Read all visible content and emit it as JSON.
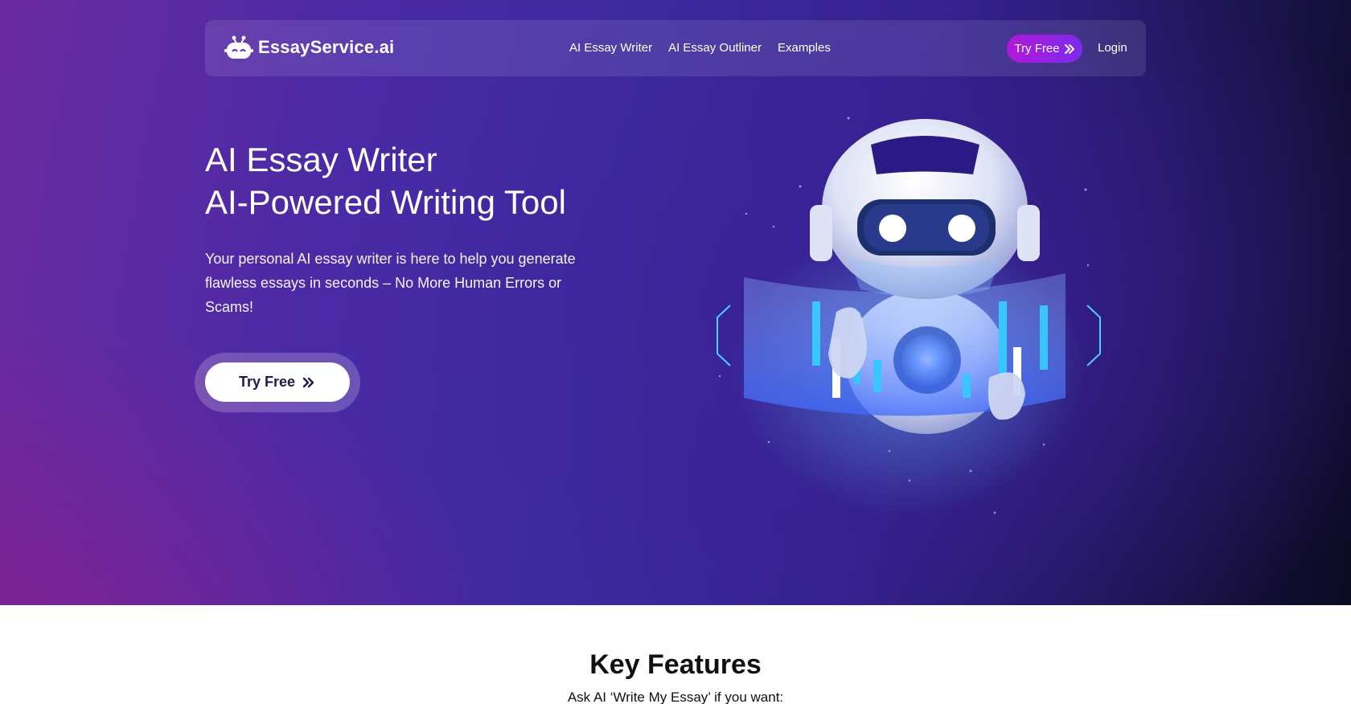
{
  "brand": {
    "name": "EssayService.ai",
    "icon": "robot-face-icon"
  },
  "nav": {
    "links": [
      "AI Essay Writer",
      "AI Essay Outliner",
      "Examples"
    ],
    "try_free": "Try Free",
    "login": "Login"
  },
  "hero": {
    "title_line1": "AI Essay Writer",
    "title_line2": "AI-Powered Writing Tool",
    "description": "Your personal AI essay writer is here to help you generate flawless essays in seconds – No More Human Errors or Scams!",
    "cta": "Try Free"
  },
  "features": {
    "title": "Key Features",
    "subtitle": "Ask AI ‘Write My Essay’ if you want:"
  },
  "colors": {
    "accent_gradient_start": "#b218d8",
    "accent_gradient_end": "#7b2bf0",
    "hero_bg": "#3d2a9f"
  }
}
